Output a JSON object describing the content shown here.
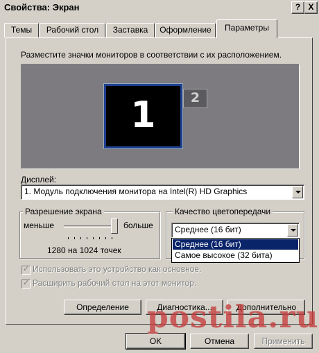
{
  "window": {
    "title": "Свойства: Экран",
    "help_button": "?",
    "close_button": "X"
  },
  "tabs": [
    "Темы",
    "Рабочий стол",
    "Заставка",
    "Оформление",
    "Параметры"
  ],
  "active_tab": "Параметры",
  "instruction": "Разместите значки мониторов в соответствии с их расположением.",
  "monitors": [
    {
      "number": "1",
      "selected": true
    },
    {
      "number": "2",
      "selected": false
    }
  ],
  "display": {
    "label": "Дисплей:",
    "value": "1. Модуль подключения монитора на Intel(R) HD Graphics"
  },
  "resolution": {
    "group_label": "Разрешение экрана",
    "less_label": "меньше",
    "more_label": "больше",
    "value_text": "1280 на 1024 точек",
    "slider_level": 1.0
  },
  "color_quality": {
    "group_label": "Качество цветопередачи",
    "value": "Среднее (16 бит)",
    "options": [
      "Среднее (16 бит)",
      "Самое высокое (32 бита)"
    ],
    "highlighted_option": "Среднее (16 бит)"
  },
  "checkboxes": [
    {
      "label": "Использовать это устройство как основное.",
      "checked": true,
      "enabled": false
    },
    {
      "label": "Расширить рабочий стол на этот монитор.",
      "checked": true,
      "enabled": false
    }
  ],
  "panel_buttons": {
    "identify": "Определение",
    "diagnostics": "Диагностика...",
    "advanced": "Дополнительно"
  },
  "dialog_buttons": {
    "ok": "OK",
    "cancel": "Отмена",
    "apply": "Применить"
  },
  "watermark": "postila.ru"
}
